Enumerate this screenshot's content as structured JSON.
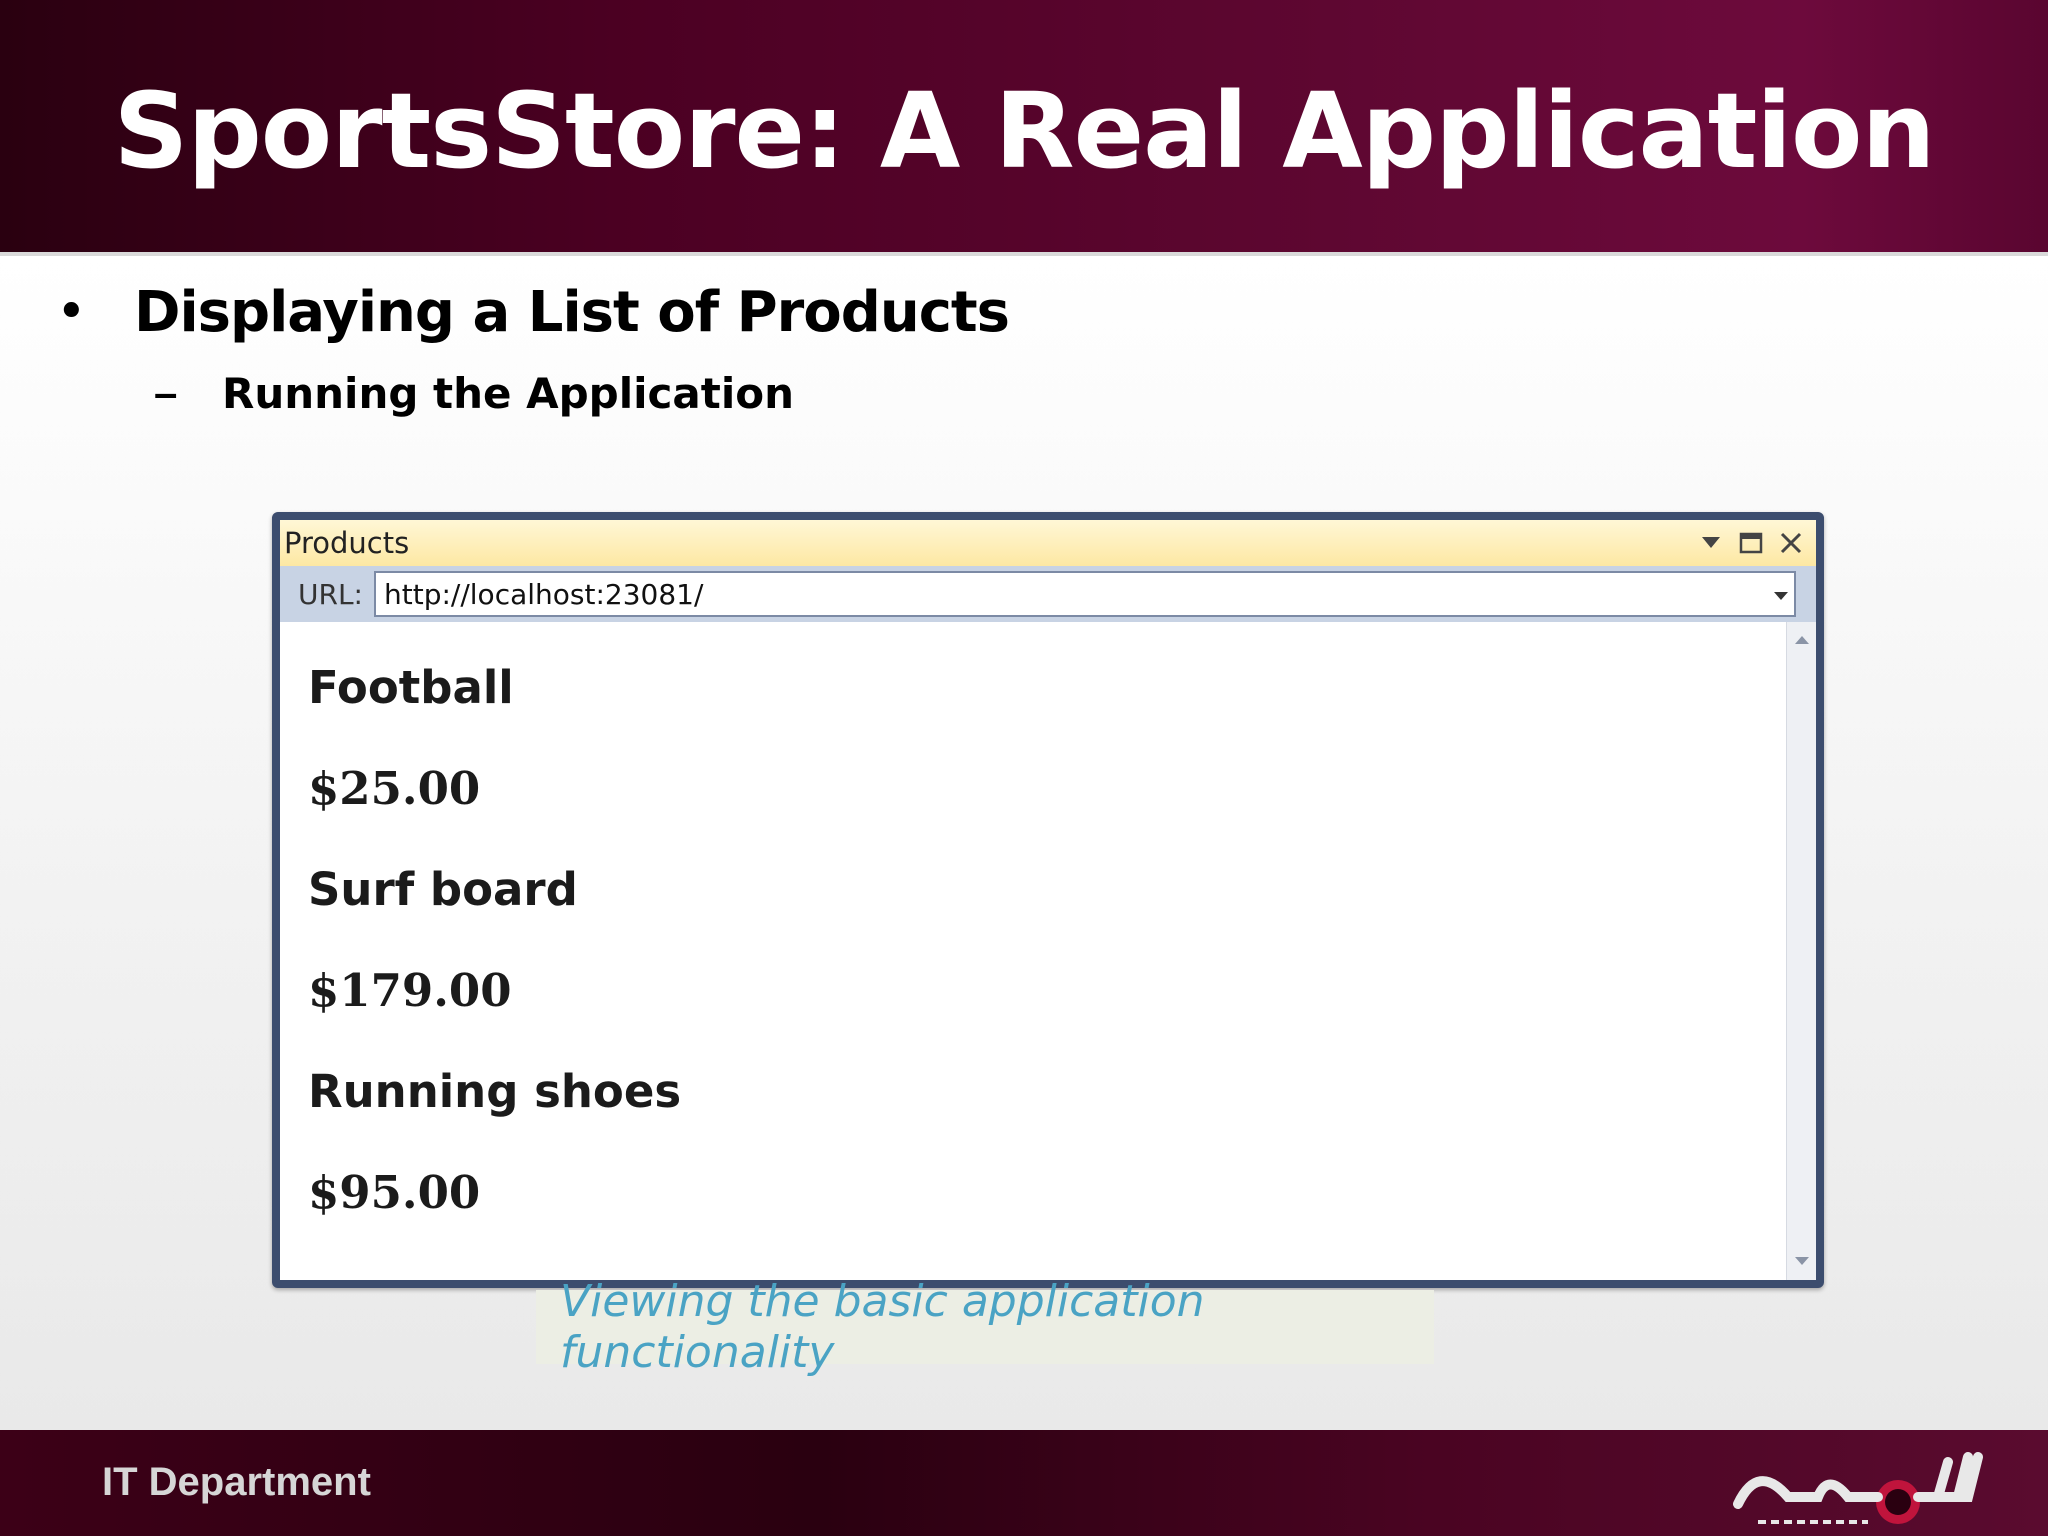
{
  "slide": {
    "title": "SportsStore: A Real Application",
    "bullet": "Displaying a List of Products",
    "sub_bullet": "Running the Application",
    "caption": "Viewing the basic application functionality",
    "footer_dept": "IT Department"
  },
  "window": {
    "title": "Products",
    "url_label": "URL:",
    "url": "http://localhost:23081/"
  },
  "products": [
    {
      "name": "Football",
      "price": "$25.00"
    },
    {
      "name": "Surf board",
      "price": "$179.00"
    },
    {
      "name": "Running shoes",
      "price": "$95.00"
    }
  ],
  "icons": {
    "bullet": "•",
    "dash": "–",
    "dropdown": "chevron-down-icon",
    "maximize": "maximize-icon",
    "close": "close-icon"
  },
  "colors": {
    "header_bg": "#5e0731",
    "window_border": "#3c4d6e",
    "titlebar_bg": "#fde8a3",
    "caption_text": "#4aa3c4"
  }
}
